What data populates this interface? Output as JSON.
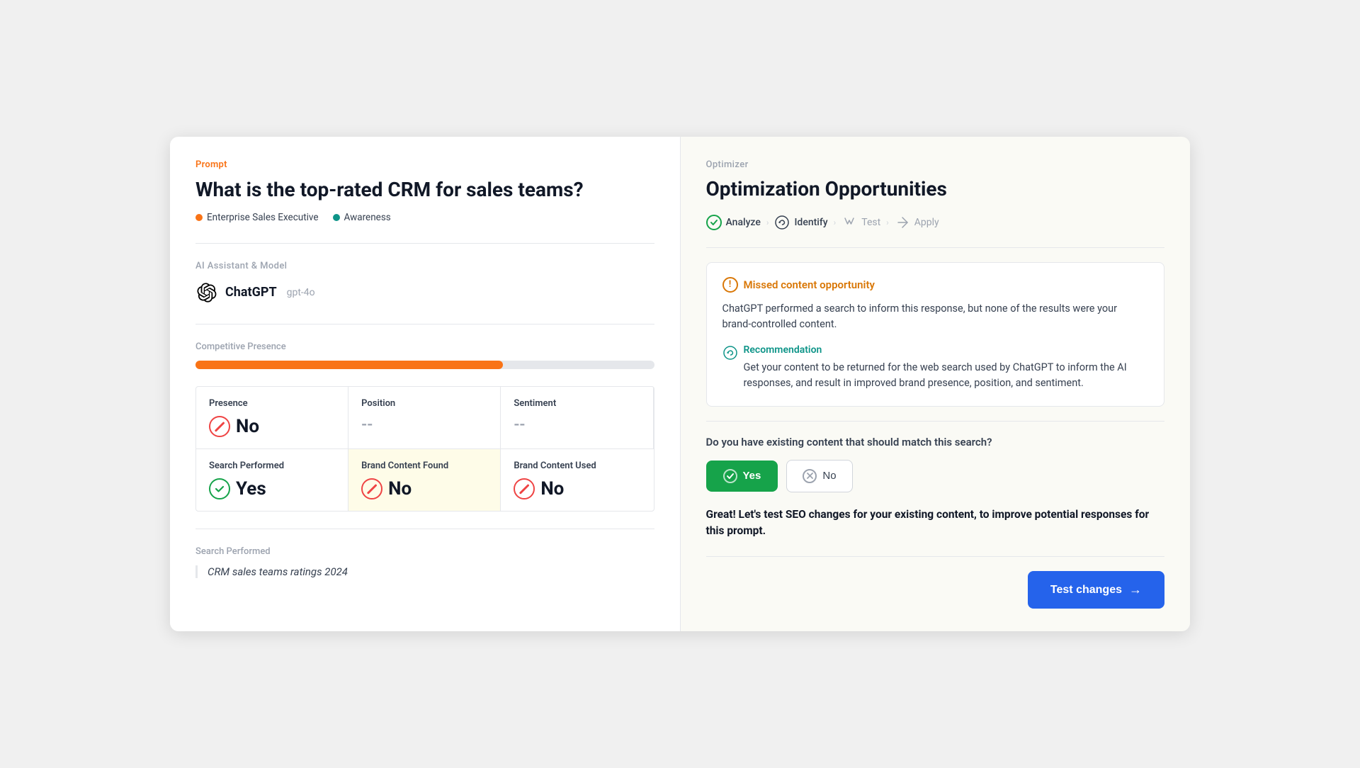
{
  "left": {
    "prompt_label": "Prompt",
    "prompt_title": "What is the top-rated CRM for sales teams?",
    "personas": [
      {
        "label": "Enterprise Sales Executive",
        "color": "orange"
      },
      {
        "label": "Awareness",
        "color": "teal"
      }
    ],
    "ai_section_label": "AI Assistant & Model",
    "ai_name": "ChatGPT",
    "ai_model": "gpt-4o",
    "competitive_label": "Competitive Presence",
    "progress_pct": 67,
    "metrics": [
      {
        "header": "Presence",
        "value": "No",
        "type": "no",
        "row": 1,
        "col": 1
      },
      {
        "header": "Position",
        "value": "--",
        "type": "dash",
        "row": 1,
        "col": 2
      },
      {
        "header": "Sentiment",
        "value": "--",
        "type": "dash",
        "row": 1,
        "col": 3
      },
      {
        "header": "Search Performed",
        "value": "Yes",
        "type": "yes",
        "row": 2,
        "col": 1
      },
      {
        "header": "Brand Content Found",
        "value": "No",
        "type": "no",
        "row": 2,
        "col": 2,
        "highlight": true
      },
      {
        "header": "Brand Content Used",
        "value": "No",
        "type": "no",
        "row": 2,
        "col": 3
      }
    ],
    "search_performed_label": "Search Performed",
    "search_query": "CRM sales teams ratings 2024"
  },
  "right": {
    "optimizer_label": "Optimizer",
    "optimizer_title": "Optimization Opportunities",
    "steps": [
      {
        "label": "Analyze",
        "state": "done"
      },
      {
        "label": "Identify",
        "state": "active"
      },
      {
        "label": "Test",
        "state": "inactive"
      },
      {
        "label": "Apply",
        "state": "inactive"
      }
    ],
    "opportunity": {
      "icon_label": "!",
      "title": "Missed content opportunity",
      "text": "ChatGPT performed a search to inform this response, but none of the results were your brand-controlled content."
    },
    "recommendation": {
      "label": "Recommendation",
      "text": "Get your content to be returned for the web search used by ChatGPT to inform the AI responses, and result in improved brand presence, position, and sentiment."
    },
    "existing_content_question": "Do you have existing content that should match this search?",
    "yes_label": "Yes",
    "no_label": "No",
    "result_text": "Great! Let's test SEO changes for your existing content, to improve potential responses for this prompt.",
    "test_changes_label": "Test changes"
  }
}
